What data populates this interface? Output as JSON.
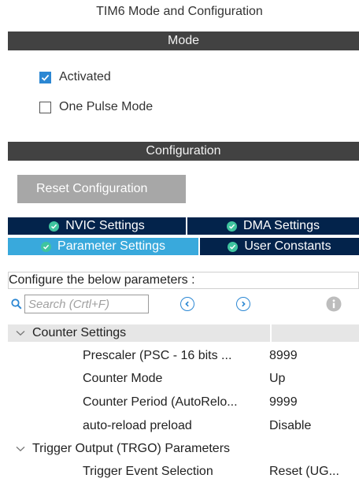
{
  "window": {
    "title": "TIM6 Mode and Configuration"
  },
  "mode": {
    "header": "Mode",
    "activated": {
      "label": "Activated",
      "checked": true
    },
    "one_pulse": {
      "label": "One Pulse Mode",
      "checked": false
    }
  },
  "configuration": {
    "header": "Configuration",
    "reset_label": "Reset Configuration",
    "tabs": [
      {
        "label": "NVIC Settings",
        "active": false
      },
      {
        "label": "DMA Settings",
        "active": false
      },
      {
        "label": "Parameter Settings",
        "active": true
      },
      {
        "label": "User Constants",
        "active": false
      }
    ],
    "description": "Configure the below parameters :",
    "search": {
      "placeholder": "Search (Crtl+F)"
    },
    "groups": [
      {
        "label": "Counter Settings",
        "params": [
          {
            "name": "Prescaler (PSC - 16 bits ...",
            "value": "8999"
          },
          {
            "name": "Counter Mode",
            "value": "Up"
          },
          {
            "name": "Counter Period (AutoRelo...",
            "value": "9999"
          },
          {
            "name": "auto-reload preload",
            "value": "Disable"
          }
        ]
      },
      {
        "label": "Trigger Output (TRGO) Parameters",
        "params": [
          {
            "name": "Trigger Event Selection",
            "value": "Reset (UG..."
          }
        ]
      }
    ]
  },
  "colors": {
    "section_bar": "#424242",
    "tab_dark": "#03234b",
    "tab_active": "#39a9dc",
    "tab_check": "#3fc49f",
    "accent": "#2b87d3"
  },
  "icons": {
    "search": "magnifier-icon",
    "prev": "chevron-left-circle-icon",
    "next": "chevron-right-circle-icon",
    "info": "info-circle-icon"
  }
}
